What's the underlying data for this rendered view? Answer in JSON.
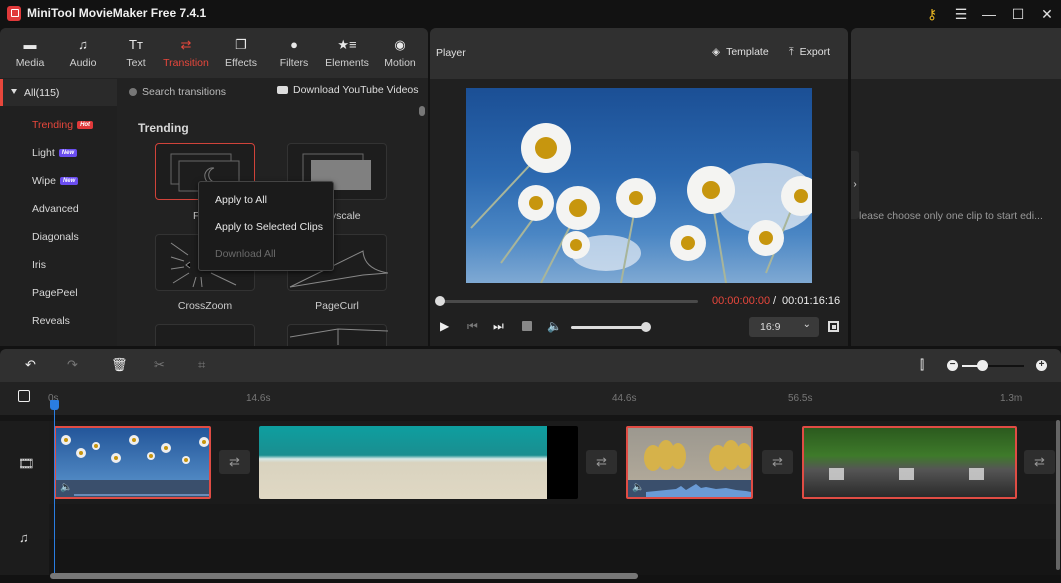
{
  "app": {
    "title": "MiniTool MovieMaker Free 7.4.1",
    "window_controls": [
      "key-icon",
      "menu-icon",
      "minimize-icon",
      "maximize-icon",
      "close-icon"
    ]
  },
  "toolbar": {
    "active": "Transition",
    "items": [
      {
        "label": "Media",
        "icon": "folder-icon"
      },
      {
        "label": "Audio",
        "icon": "music-note-icon"
      },
      {
        "label": "Text",
        "icon": "text-icon"
      },
      {
        "label": "Transition",
        "icon": "swap-arrows-icon"
      },
      {
        "label": "Effects",
        "icon": "effects-icon"
      },
      {
        "label": "Filters",
        "icon": "filters-icon"
      },
      {
        "label": "Elements",
        "icon": "elements-icon"
      },
      {
        "label": "Motion",
        "icon": "motion-icon"
      }
    ]
  },
  "library": {
    "category_header": "All(115)",
    "search_placeholder": "Search transitions",
    "download_label": "Download YouTube Videos",
    "categories": [
      {
        "label": "Trending",
        "badge": "Hot",
        "badge_color": "#e0393a",
        "active": true
      },
      {
        "label": "Light",
        "badge": "New",
        "badge_color": "#6a4df0"
      },
      {
        "label": "Wipe",
        "badge": "New",
        "badge_color": "#6a4df0"
      },
      {
        "label": "Advanced"
      },
      {
        "label": "Diagonals"
      },
      {
        "label": "Iris"
      },
      {
        "label": "PagePeel"
      },
      {
        "label": "Reveals"
      }
    ],
    "section_title": "Trending",
    "transitions": [
      {
        "label": "Fade",
        "selected": true
      },
      {
        "label": "Grayscale"
      },
      {
        "label": "CrossZoom"
      },
      {
        "label": "PageCurl"
      }
    ]
  },
  "context_menu": {
    "items": [
      {
        "label": "Apply to All",
        "enabled": true
      },
      {
        "label": "Apply to Selected Clips",
        "enabled": true
      },
      {
        "label": "Download All",
        "enabled": false
      }
    ]
  },
  "player": {
    "title": "Player",
    "template_label": "Template",
    "export_label": "Export",
    "time_current": "00:00:00:00",
    "time_separator": "/",
    "time_total": "00:01:16:16",
    "progress": 0,
    "volume": 1.0,
    "aspect_ratio": "16:9"
  },
  "properties": {
    "message": "lease choose only one clip to start edi..."
  },
  "timeline": {
    "ruler_ticks": [
      "0s",
      "14.6s",
      "44.6s",
      "56.5s",
      "1.3m"
    ],
    "zoom_level": 0.3,
    "clips": [
      {
        "name": "daisies",
        "selected": true,
        "has_audio": true
      },
      {
        "name": "beach",
        "selected": false,
        "has_audio": false
      },
      {
        "name": "ducklings",
        "selected": true,
        "has_audio": true
      },
      {
        "name": "waterfall",
        "selected": true,
        "has_audio": false
      }
    ],
    "accent_color": "#2a7de1",
    "selection_color": "#e04c44"
  }
}
